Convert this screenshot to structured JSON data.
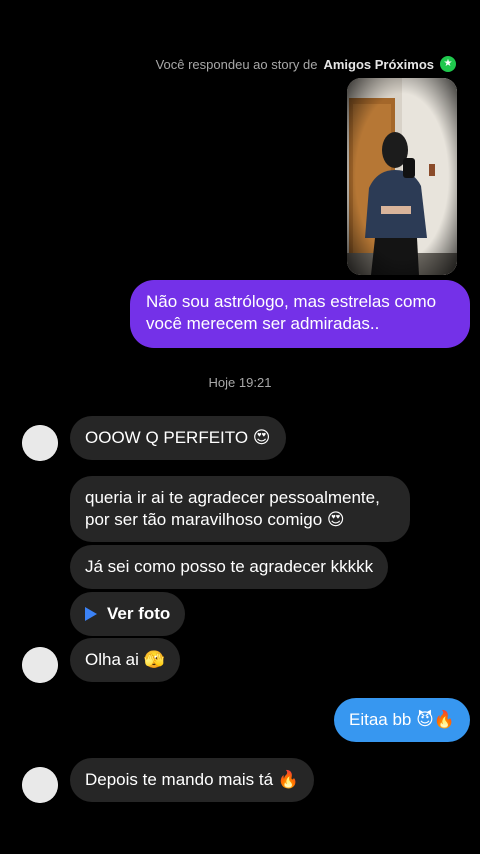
{
  "story_reply": {
    "prefix": "Você respondeu ao story de",
    "audience": "Amigos Próximos",
    "badge_icon": "close-friends-star-icon",
    "badge_glyph": "★",
    "badge_color": "#1fc84d"
  },
  "messages": {
    "outgoing_1": "Não sou astrólogo, mas estrelas como você merecem ser admiradas..",
    "timestamp": "Hoje 19:21",
    "incoming_1": "OOOW Q PERFEITO 😍",
    "incoming_2": "queria ir ai te agradecer pessoalmente, por ser tão maravilhoso comigo 😍",
    "incoming_3": "Já sei como posso te agradecer kkkkk",
    "incoming_photo_label": "Ver foto",
    "incoming_4": "Olha ai 🫣",
    "outgoing_2": "Eitaa bb 😈🔥",
    "incoming_5": "Depois te mando mais tá 🔥"
  },
  "colors": {
    "purple_bubble": "#7431e8",
    "blue_bubble": "#3797f0",
    "incoming_bubble": "#262626"
  }
}
